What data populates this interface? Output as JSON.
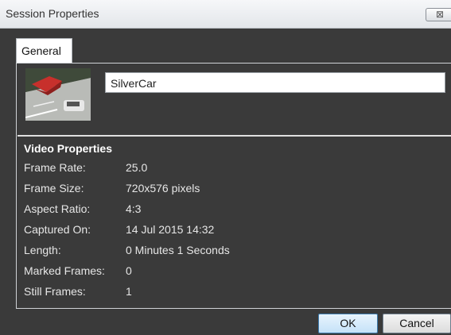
{
  "window": {
    "title": "Session Properties",
    "close_glyph": "⊠"
  },
  "tabs": [
    {
      "label": "General"
    }
  ],
  "session": {
    "name": "SilverCar"
  },
  "video_properties": {
    "heading": "Video Properties",
    "rows": [
      {
        "label": "Frame Rate:",
        "value": "25.0"
      },
      {
        "label": "Frame Size:",
        "value": "720x576 pixels"
      },
      {
        "label": "Aspect Ratio:",
        "value": "4:3"
      },
      {
        "label": "Captured On:",
        "value": "14 Jul 2015 14:32"
      },
      {
        "label": "Length:",
        "value": "0 Minutes 1 Seconds"
      },
      {
        "label": "Marked Frames:",
        "value": "0"
      },
      {
        "label": "Still Frames:",
        "value": "1"
      }
    ]
  },
  "buttons": {
    "ok": "OK",
    "cancel": "Cancel"
  }
}
